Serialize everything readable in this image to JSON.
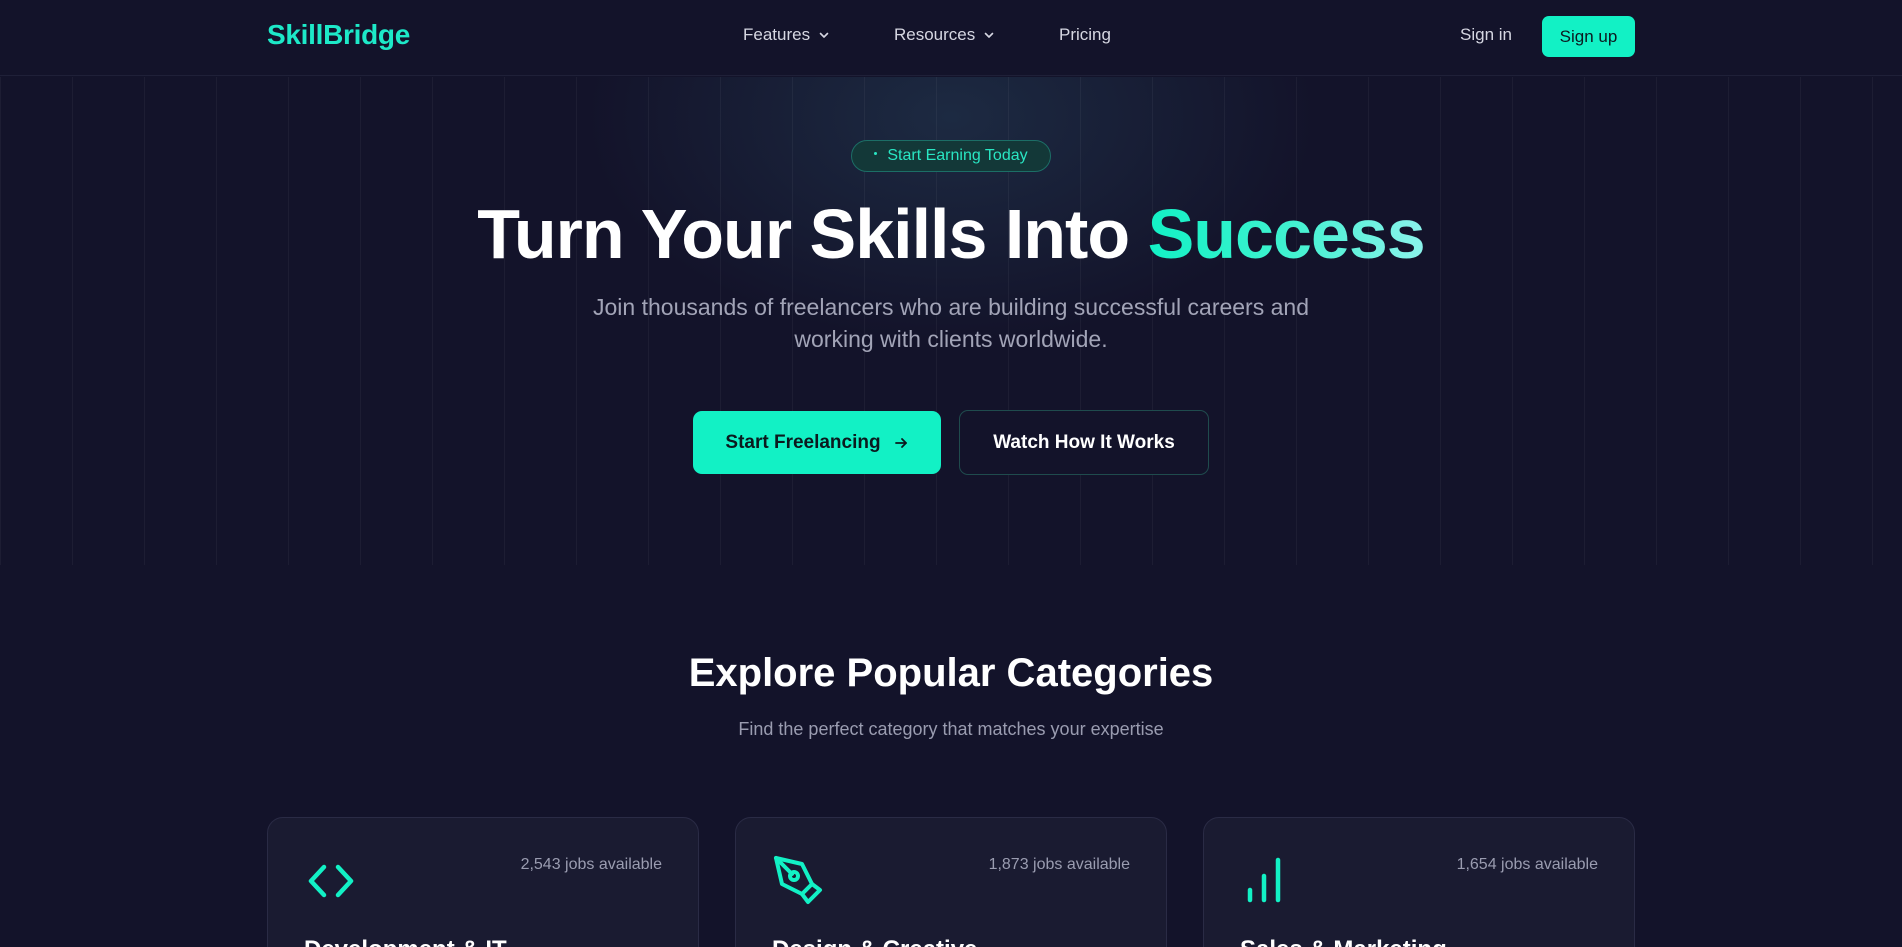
{
  "nav": {
    "logo": "SkillBridge",
    "links": [
      {
        "label": "Features"
      },
      {
        "label": "Resources"
      },
      {
        "label": "Pricing"
      }
    ],
    "sign_in": "Sign in",
    "sign_up": "Sign up"
  },
  "hero": {
    "badge": "Start Earning Today",
    "headline_main": "Turn Your Skills Into ",
    "headline_accent": "Success",
    "subhead": "Join thousands of freelancers who are building successful careers and working with clients worldwide.",
    "primary_cta": "Start Freelancing",
    "secondary_cta": "Watch How It Works"
  },
  "categories": {
    "title": "Explore Popular Categories",
    "subtitle": "Find the perfect category that matches your expertise",
    "items": [
      {
        "name": "Development & IT",
        "jobs": "2,543 jobs available",
        "icon": "code-icon"
      },
      {
        "name": "Design & Creative",
        "jobs": "1,873 jobs available",
        "icon": "pen-tool-icon"
      },
      {
        "name": "Sales & Marketing",
        "jobs": "1,654 jobs available",
        "icon": "bar-chart-icon"
      }
    ]
  },
  "colors": {
    "accent": "#12f1c5",
    "background": "#13132a",
    "card": "#1a1b31",
    "muted_text": "#9a9cb0"
  }
}
